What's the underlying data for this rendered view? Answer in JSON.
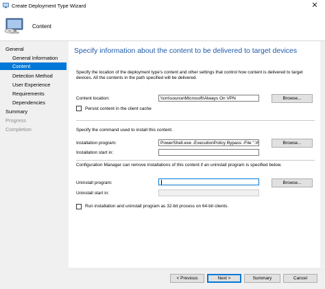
{
  "window": {
    "title": "Create Deployment Type Wizard",
    "close_glyph": "✕"
  },
  "header": {
    "page_title": "Content",
    "icon": "computer-with-disc-icon"
  },
  "nav": {
    "items": [
      {
        "label": "General",
        "level": 0,
        "state": "normal"
      },
      {
        "label": "General Information",
        "level": 1,
        "state": "normal"
      },
      {
        "label": "Content",
        "level": 1,
        "state": "selected"
      },
      {
        "label": "Detection Method",
        "level": 1,
        "state": "normal"
      },
      {
        "label": "User Experience",
        "level": 1,
        "state": "normal"
      },
      {
        "label": "Requirements",
        "level": 1,
        "state": "normal"
      },
      {
        "label": "Dependencies",
        "level": 1,
        "state": "normal"
      },
      {
        "label": "Summary",
        "level": 0,
        "state": "normal"
      },
      {
        "label": "Progress",
        "level": 0,
        "state": "disabled"
      },
      {
        "label": "Completion",
        "level": 0,
        "state": "disabled"
      }
    ]
  },
  "main": {
    "heading": "Specify information about the content to be delivered to target devices",
    "description": "Specify the location of the deployment type's content and other settings that control how content is delivered to target devices. All the contents in the path specified will be delivered.",
    "content_location": {
      "label": "Content location:",
      "value": "\\\\cm\\source\\Microsoft\\Always On VPN",
      "browse": "Browse..."
    },
    "persist_cache": {
      "label": "Persist content in the client cache",
      "checked": false
    },
    "install_section_label": "Specify the command used to install this content.",
    "installation_program": {
      "label": "Installation program:",
      "value": "PowerShell.exe -ExecutionPolicy Bypass -File \".\\Ne\\",
      "browse": "Browse..."
    },
    "installation_start_in": {
      "label": "Installation start in:",
      "value": ""
    },
    "uninstall_note": "Configuration Manager can remove installations of this content if an uninstall program is specified below.",
    "uninstall_program": {
      "label": "Uninstall program:",
      "value": "",
      "browse": "Browse..."
    },
    "uninstall_start_in": {
      "label": "Uninstall start in:",
      "value": ""
    },
    "run_32bit": {
      "label": "Run installation and uninstall program as 32-bit process on 64-bit clients.",
      "checked": false
    }
  },
  "footer": {
    "previous": "< Previous",
    "next": "Next >",
    "summary": "Summary",
    "cancel": "Cancel"
  },
  "colors": {
    "accent": "#0078d7",
    "heading": "#1e5aa8",
    "disabled_text": "#8c8c8c"
  }
}
